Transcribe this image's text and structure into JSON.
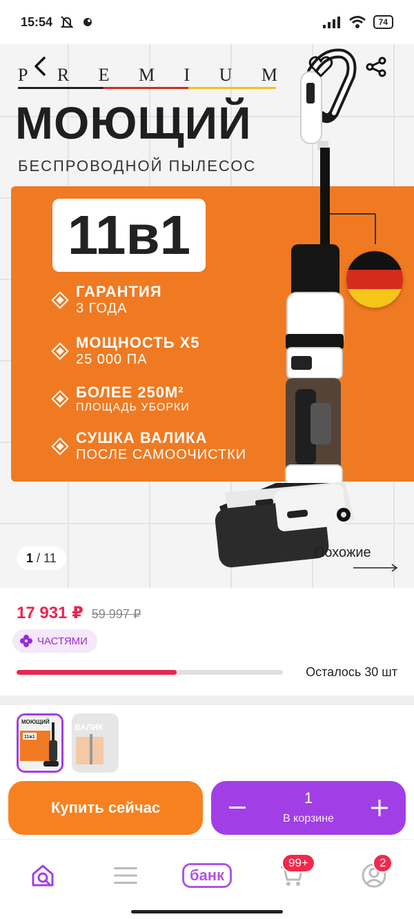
{
  "status_bar": {
    "time": "15:54",
    "battery": "74"
  },
  "hero": {
    "premium_letters": [
      "P",
      "R",
      "E",
      "M",
      "I",
      "U",
      "M"
    ],
    "title": "МОЮЩИЙ",
    "subtitle": "БЕСПРОВОДНОЙ ПЫЛЕСОС",
    "badge": "11в1",
    "features": [
      {
        "title": "ГАРАНТИЯ",
        "sub": "3 ГОДА"
      },
      {
        "title": "МОЩНОСТЬ Х5",
        "sub": "25 000 ПА"
      },
      {
        "title": "БОЛЕЕ 250М²",
        "sub": "ПЛОЩАДЬ УБОРКИ"
      },
      {
        "title": "СУШКА ВАЛИКА",
        "sub": "ПОСЛЕ САМООЧИСТКИ"
      }
    ],
    "page_current": "1",
    "page_total": "/ 11",
    "similar_label": "Похожие"
  },
  "product": {
    "price": "17 931 ₽",
    "old_price": "59 997 ₽",
    "installment_label": "ЧАСТЯМИ",
    "stock_text": "Осталось 30 шт",
    "stock_fraction": 0.6
  },
  "thumbnails": [
    {
      "title": "МОЮЩИЙ",
      "badge": "11в1"
    },
    {
      "title": "ВАЛИК"
    }
  ],
  "actions": {
    "buy_label": "Купить сейчас",
    "cart_count": "1",
    "cart_label": "В корзине"
  },
  "bottom_nav": {
    "bank_label": "банк",
    "cart_badge": "99+",
    "profile_badge": "2"
  },
  "colors": {
    "accent_pink": "#e8264e",
    "accent_purple": "#a23ee6",
    "accent_orange": "#f7811f",
    "banner_orange": "#f07a22"
  }
}
